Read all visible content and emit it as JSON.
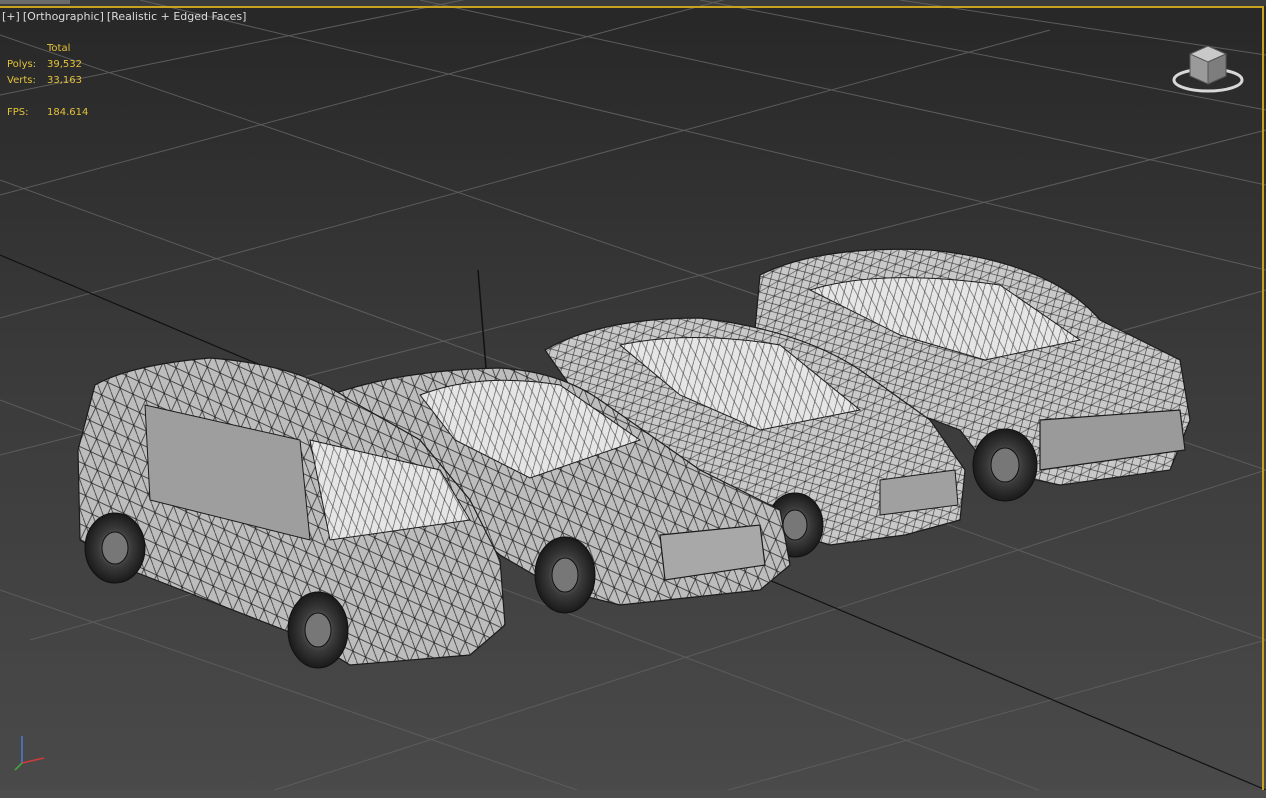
{
  "viewport": {
    "labels": [
      "[+]",
      "[Orthographic]",
      "[Realistic + Edged Faces]"
    ],
    "stats": {
      "header": "Total",
      "rows": [
        {
          "key": "Polys:",
          "value": "39,532"
        },
        {
          "key": "Verts:",
          "value": "33,163"
        }
      ],
      "fps_key": "FPS:",
      "fps_value": "184.614"
    }
  },
  "viewcube": {
    "icon": "viewcube-icon"
  },
  "axis_tripod": {
    "icon": "axis-tripod-icon"
  },
  "colors": {
    "frame": "#c8a21e",
    "stats_text": "#e3c23a",
    "grid": "#5a5a5a",
    "mesh": "#d8d8d8"
  }
}
